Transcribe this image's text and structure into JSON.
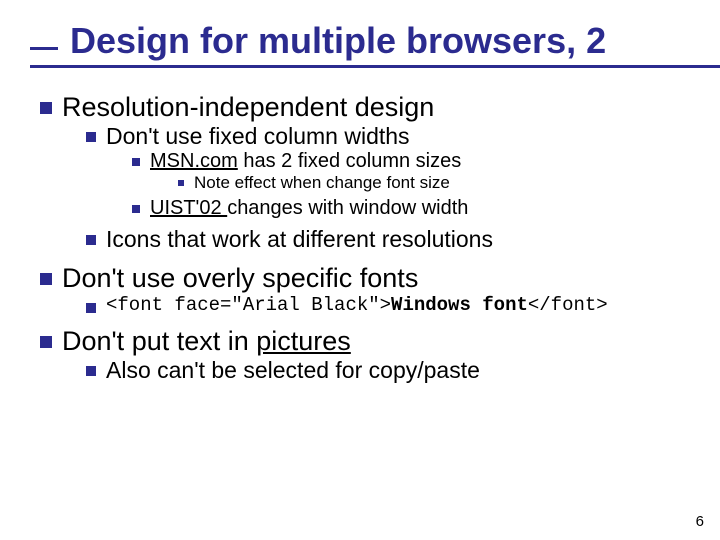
{
  "title": "Design for multiple browsers, 2",
  "b1": {
    "t": "Resolution-independent design",
    "c1": {
      "t": "Don't use fixed column widths",
      "g1": {
        "pre": "",
        "link": "MSN.com",
        "post": " has 2 fixed column sizes",
        "note": "Note effect when change font size"
      },
      "g2": {
        "link": "UIST'02 ",
        "post": "changes with window width"
      }
    },
    "c2": {
      "t": "Icons that work at different resolutions"
    }
  },
  "b2": {
    "t": "Don't use overly specific fonts",
    "code_open": "<font face=\"Arial Black\">",
    "code_bold": "Windows font",
    "code_close": "</font>"
  },
  "b3": {
    "pre": "Don't put text in ",
    "link": "pictures",
    "c1": {
      "t": "Also can't be selected for copy/paste"
    }
  },
  "page_number": "6"
}
